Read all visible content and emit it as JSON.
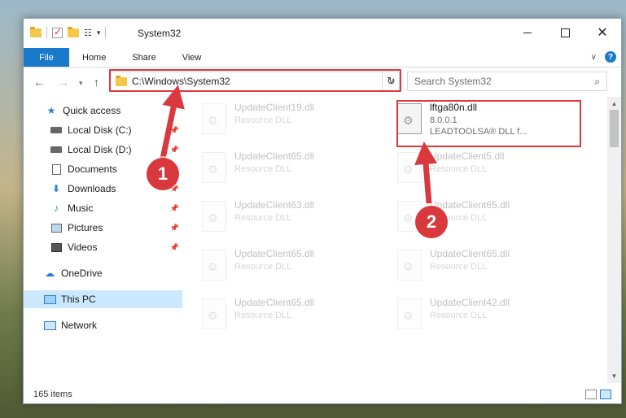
{
  "window": {
    "title": "System32",
    "controls": {
      "minimize": "minimize",
      "maximize": "maximize",
      "close": "✕"
    }
  },
  "ribbon": {
    "tabs": [
      "File",
      "Home",
      "Share",
      "View"
    ],
    "help": "?"
  },
  "address": {
    "path": "C:\\Windows\\System32",
    "search_placeholder": "Search System32"
  },
  "sidebar": {
    "items": [
      {
        "label": "Quick access",
        "icon": "star-icon"
      },
      {
        "label": "Local Disk (C:)",
        "icon": "drive-icon"
      },
      {
        "label": "Local Disk (D:)",
        "icon": "drive-icon"
      },
      {
        "label": "Documents",
        "icon": "document-icon"
      },
      {
        "label": "Downloads",
        "icon": "download-icon"
      },
      {
        "label": "Music",
        "icon": "music-icon"
      },
      {
        "label": "Pictures",
        "icon": "pictures-icon"
      },
      {
        "label": "Videos",
        "icon": "videos-icon"
      },
      {
        "label": "OneDrive",
        "icon": "cloud-icon"
      },
      {
        "label": "This PC",
        "icon": "computer-icon"
      },
      {
        "label": "Network",
        "icon": "network-icon"
      }
    ]
  },
  "files": {
    "left_column": [
      {
        "name": "UpdateClient19.dll",
        "sub": "Resource DLL"
      },
      {
        "name": "UpdateClient65.dll",
        "sub": "Resource DLL"
      },
      {
        "name": "UpdateClient63.dll",
        "sub": "Resource DLL"
      },
      {
        "name": "UpdateClient65.dll",
        "sub": "Resource DLL"
      },
      {
        "name": "UpdateClient65.dll",
        "sub": "Resource DLL"
      }
    ],
    "right_column": [
      {
        "name": "UpdateClient5.dll",
        "sub": "Resource DLL"
      },
      {
        "name": "UpdateClient65.dll",
        "sub": "Resource DLL"
      },
      {
        "name": "UpdateClient65.dll",
        "sub": "Resource DLL"
      },
      {
        "name": "UpdateClient42.dll",
        "sub": "Resource DLL"
      }
    ],
    "highlighted": {
      "name": "lftga80n.dll",
      "version": "8.0.0.1",
      "description": "LEADTOOLSA® DLL f..."
    }
  },
  "status": {
    "item_count": "165 items"
  },
  "annotations": {
    "step1": "1",
    "step2": "2",
    "color": "#d9393d"
  }
}
